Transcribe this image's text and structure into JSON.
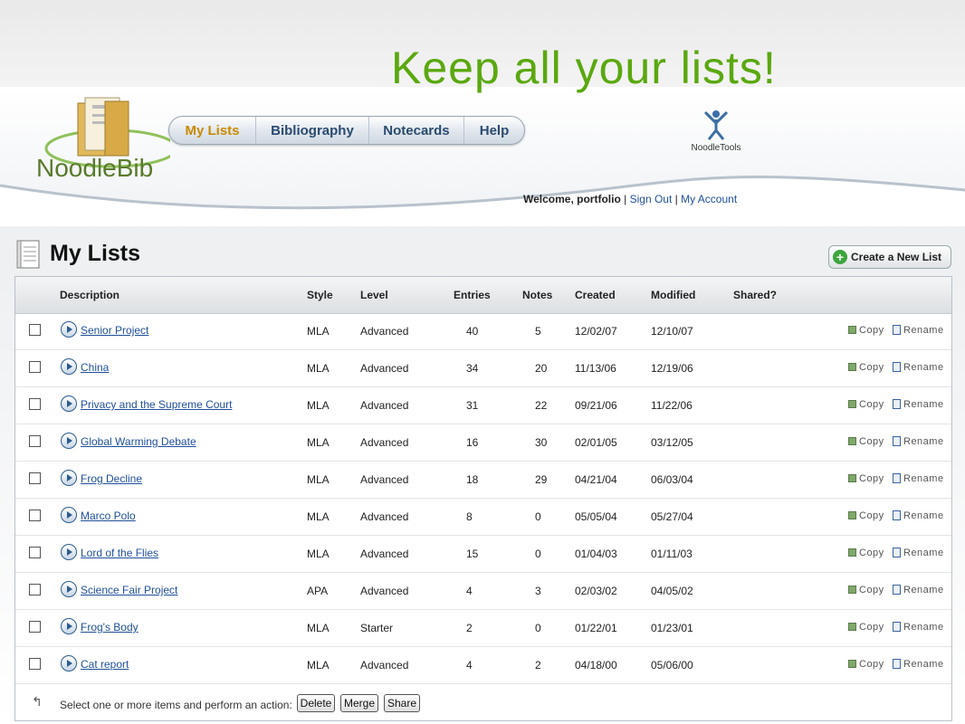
{
  "headline": "Keep all your lists!",
  "brand": {
    "logo_text": "NoodleBib",
    "partner_logo_text": "NoodleTools",
    "accent": "#5aa80f"
  },
  "nav": {
    "tabs": [
      {
        "label": "My Lists",
        "active": true
      },
      {
        "label": "Bibliography",
        "active": false
      },
      {
        "label": "Notecards",
        "active": false
      },
      {
        "label": "Help",
        "active": false
      }
    ]
  },
  "user": {
    "welcome": "Welcome, portfolio",
    "sep1": "|",
    "sign_out": "Sign Out",
    "sep2": "|",
    "my_account": "My Account"
  },
  "page": {
    "title": "My Lists",
    "create_label": "Create a New List",
    "icon": "notepad-icon"
  },
  "table": {
    "headers": {
      "description": "Description",
      "style": "Style",
      "level": "Level",
      "entries": "Entries",
      "notes": "Notes",
      "created": "Created",
      "modified": "Modified",
      "shared": "Shared?"
    },
    "action_copy": "Copy",
    "action_rename": "Rename",
    "rows": [
      {
        "description": "Senior Project",
        "style": "MLA",
        "level": "Advanced",
        "entries": "40",
        "notes": "5",
        "created": "12/02/07",
        "modified": "12/10/07"
      },
      {
        "description": "China",
        "style": "MLA",
        "level": "Advanced",
        "entries": "34",
        "notes": "20",
        "created": "11/13/06",
        "modified": "12/19/06"
      },
      {
        "description": "Privacy and the Supreme Court",
        "style": "MLA",
        "level": "Advanced",
        "entries": "31",
        "notes": "22",
        "created": "09/21/06",
        "modified": "11/22/06"
      },
      {
        "description": "Global Warming Debate",
        "style": "MLA",
        "level": "Advanced",
        "entries": "16",
        "notes": "30",
        "created": "02/01/05",
        "modified": "03/12/05"
      },
      {
        "description": "Frog Decline",
        "style": "MLA",
        "level": "Advanced",
        "entries": "18",
        "notes": "29",
        "created": "04/21/04",
        "modified": "06/03/04"
      },
      {
        "description": "Marco Polo",
        "style": "MLA",
        "level": "Advanced",
        "entries": "8",
        "notes": "0",
        "created": "05/05/04",
        "modified": "05/27/04"
      },
      {
        "description": "Lord of the Flies",
        "style": "MLA",
        "level": "Advanced",
        "entries": "15",
        "notes": "0",
        "created": "01/04/03",
        "modified": "01/11/03"
      },
      {
        "description": "Science Fair Project",
        "style": "APA",
        "level": "Advanced",
        "entries": "4",
        "notes": "3",
        "created": "02/03/02",
        "modified": "04/05/02"
      },
      {
        "description": "Frog's Body",
        "style": "MLA",
        "level": "Starter",
        "entries": "2",
        "notes": "0",
        "created": "01/22/01",
        "modified": "01/23/01"
      },
      {
        "description": "Cat report",
        "style": "MLA",
        "level": "Advanced",
        "entries": "4",
        "notes": "2",
        "created": "04/18/00",
        "modified": "05/06/00"
      }
    ]
  },
  "footer": {
    "instruction": "Select one or more items and perform an action:",
    "delete": "Delete",
    "merge": "Merge",
    "share": "Share"
  }
}
